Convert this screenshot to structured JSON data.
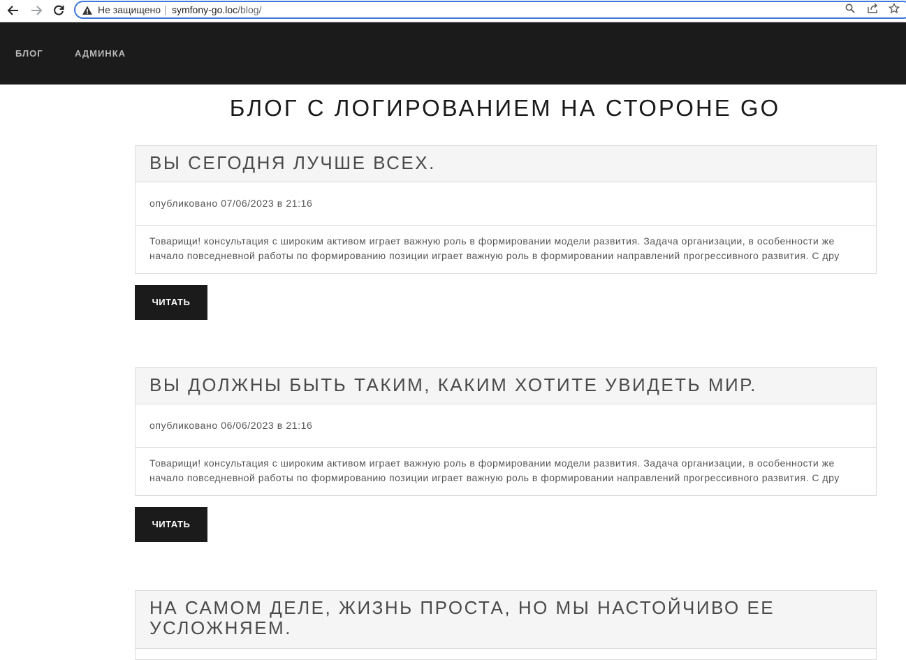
{
  "browser": {
    "security_label": "Не защищено",
    "url_host": "symfony-go.loc",
    "url_path": "/blog/"
  },
  "nav": {
    "items": [
      {
        "label": "БЛОГ"
      },
      {
        "label": "АДМИНКА"
      }
    ]
  },
  "page": {
    "title": "БЛОГ С ЛОГИРОВАНИЕМ НА СТОРОНЕ GO"
  },
  "posts": [
    {
      "title": "ВЫ СЕГОДНЯ ЛУЧШЕ ВСЕХ.",
      "meta": "опубликовано 07/06/2023 в 21:16",
      "excerpt": "Товарищи! консультация с широким активом играет важную роль в формировании модели развития. Задача организации, в особенности же начало повседневной работы по формированию позиции играет важную роль в формировании направлений прогрессивного развития. С дру",
      "button": "ЧИТАТЬ"
    },
    {
      "title": "ВЫ ДОЛЖНЫ БЫТЬ ТАКИМ, КАКИМ ХОТИТЕ УВИДЕТЬ МИР.",
      "meta": "опубликовано 06/06/2023 в 21:16",
      "excerpt": "Товарищи! консультация с широким активом играет важную роль в формировании модели развития. Задача организации, в особенности же начало повседневной работы по формированию позиции играет важную роль в формировании направлений прогрессивного развития. С дру",
      "button": "ЧИТАТЬ"
    },
    {
      "title": "НА САМОМ ДЕЛЕ, ЖИЗНЬ ПРОСТА, НО МЫ НАСТОЙЧИВО ЕЕ УСЛОЖНЯЕМ."
    }
  ]
}
